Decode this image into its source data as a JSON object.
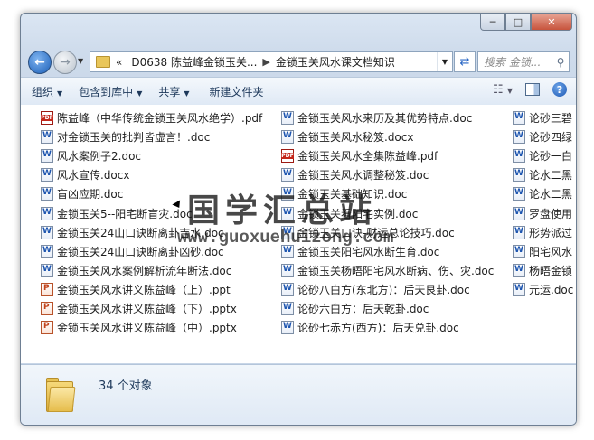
{
  "window": {
    "controls": {
      "minimize": "─",
      "maximize": "□",
      "close": "✕"
    }
  },
  "nav": {
    "back": "←",
    "forward": "→",
    "address_overflow": "«",
    "breadcrumb": [
      "D0638 陈益峰金锁玉关...",
      "金锁玉关风水课文档知识"
    ],
    "search_placeholder": "搜索 金锁..."
  },
  "toolbar": {
    "organize": "组织",
    "include_in_library": "包含到库中",
    "share": "共享",
    "new_folder": "新建文件夹"
  },
  "files": {
    "col1": [
      {
        "name": "陈益峰（中华传统金锁玉关风水绝学）.pdf",
        "type": "pdf"
      },
      {
        "name": "对金锁玉关的批判皆虚言！.doc",
        "type": "doc"
      },
      {
        "name": "风水案例子2.doc",
        "type": "doc"
      },
      {
        "name": "风水宣传.docx",
        "type": "doc"
      },
      {
        "name": "盲凶应期.doc",
        "type": "doc"
      },
      {
        "name": "金锁玉关5--阳宅断盲灾.doc",
        "type": "doc"
      },
      {
        "name": "金锁玉关24山口诀断离卦吉水.doc",
        "type": "doc"
      },
      {
        "name": "金锁玉关24山口诀断离卦凶砂.doc",
        "type": "doc"
      },
      {
        "name": "金锁玉关风水案例解析流年断法.doc",
        "type": "doc"
      },
      {
        "name": "金锁玉关风水讲义陈益峰（上）.ppt",
        "type": "ppt"
      },
      {
        "name": "金锁玉关风水讲义陈益峰（下）.pptx",
        "type": "ppt"
      },
      {
        "name": "金锁玉关风水讲义陈益峰（中）.pptx",
        "type": "ppt"
      }
    ],
    "col2": [
      {
        "name": "金锁玉关风水来历及其优势特点.doc",
        "type": "doc"
      },
      {
        "name": "金锁玉关风水秘笈.docx",
        "type": "doc"
      },
      {
        "name": "金锁玉关风水全集陈益峰.pdf",
        "type": "pdf"
      },
      {
        "name": "金锁玉关风水调整秘笈.doc",
        "type": "doc"
      },
      {
        "name": "金锁玉关基础知识.doc",
        "type": "doc"
      },
      {
        "name": "金锁玉关看阳宅实例.doc",
        "type": "doc"
      },
      {
        "name": "金锁玉关口诀-财运总论技巧.doc",
        "type": "doc"
      },
      {
        "name": "金锁玉关阳宅风水断生育.doc",
        "type": "doc"
      },
      {
        "name": "金锁玉关杨晤阳宅风水断病、伤、灾.doc",
        "type": "doc"
      },
      {
        "name": "论砂八白方(东北方)：后天艮卦.doc",
        "type": "doc"
      },
      {
        "name": "论砂六白方：后天乾卦.doc",
        "type": "doc"
      },
      {
        "name": "论砂七赤方(西方)：后天兑卦.doc",
        "type": "doc"
      }
    ],
    "col3": [
      {
        "name": "论砂三碧",
        "type": "doc"
      },
      {
        "name": "论砂四绿",
        "type": "doc"
      },
      {
        "name": "论砂一白",
        "type": "doc"
      },
      {
        "name": "论水二黑",
        "type": "doc"
      },
      {
        "name": "论水二黑",
        "type": "doc"
      },
      {
        "name": "罗盘使用",
        "type": "doc"
      },
      {
        "name": "形势派过",
        "type": "doc"
      },
      {
        "name": "阳宅风水",
        "type": "doc"
      },
      {
        "name": "杨晤金锁",
        "type": "doc"
      },
      {
        "name": "元运.doc",
        "type": "doc"
      }
    ]
  },
  "status": {
    "count": "34 个对象"
  },
  "watermark": {
    "title": "国学汇总站",
    "url": "www.guoxuehuizong.com"
  }
}
